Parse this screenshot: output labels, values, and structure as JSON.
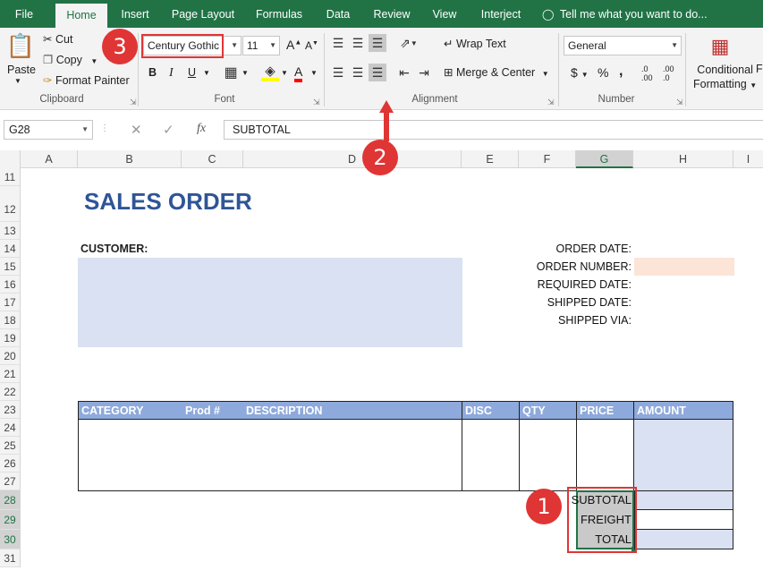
{
  "tabs": [
    "File",
    "Home",
    "Insert",
    "Page Layout",
    "Formulas",
    "Data",
    "Review",
    "View",
    "Interject"
  ],
  "tell_me": "Tell me what you want to do...",
  "clipboard": {
    "paste": "Paste",
    "cut": "Cut",
    "copy": "Copy",
    "format_painter": "Format Painter",
    "label": "Clipboard"
  },
  "font": {
    "name": "Century Gothic",
    "size": "11",
    "bold": "B",
    "italic": "I",
    "underline": "U",
    "grow": "A",
    "shrink": "A",
    "color_a": "A",
    "label": "Font"
  },
  "alignment": {
    "wrap_text": "Wrap Text",
    "merge_center": "Merge & Center",
    "label": "Alignment"
  },
  "number": {
    "format": "General",
    "currency": "$",
    "percent": "%",
    "comma": ",",
    "inc_dec_1": ".0",
    "inc_dec_2": ".00",
    "dec_dec_1": ".00",
    "dec_dec_2": ".0",
    "label": "Number"
  },
  "conditional": {
    "line1": "Conditional",
    "line2": "Formatting",
    "cut_f": "Fo"
  },
  "formula_bar": {
    "name_box": "G28",
    "fx": "fx",
    "value": "SUBTOTAL"
  },
  "columns": [
    "A",
    "B",
    "C",
    "D",
    "E",
    "F",
    "G",
    "H",
    "I"
  ],
  "rows": [
    "11",
    "12",
    "13",
    "14",
    "15",
    "16",
    "17",
    "18",
    "19",
    "20",
    "21",
    "22",
    "23",
    "24",
    "25",
    "26",
    "27",
    "28",
    "29",
    "30",
    "31"
  ],
  "sheet": {
    "title": "SALES ORDER",
    "customer_label": "CUSTOMER:",
    "order_labels": [
      "ORDER DATE:",
      "ORDER NUMBER:",
      "REQUIRED DATE:",
      "SHIPPED DATE:",
      "SHIPPED VIA:"
    ],
    "table_headers": [
      "CATEGORY",
      "Prod #",
      "DESCRIPTION",
      "DISC",
      "QTY",
      "PRICE",
      "AMOUNT"
    ],
    "totals": [
      "SUBTOTAL",
      "FREIGHT",
      "TOTAL"
    ]
  },
  "annotations": [
    "1",
    "2",
    "3"
  ],
  "colors": {
    "excel_green": "#217346",
    "header_blue": "#8ea9db",
    "light_blue": "#d9e1f2",
    "peach": "#fce4d6",
    "title_blue": "#2f5597",
    "annot_red": "#e03535"
  }
}
